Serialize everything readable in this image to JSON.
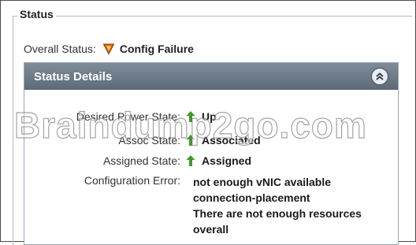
{
  "group": {
    "legend": "Status"
  },
  "overall": {
    "label": "Overall Status:",
    "value": "Config Failure",
    "icon": "warning-triangle-icon",
    "icon_color": "#e06a10"
  },
  "details": {
    "title": "Status Details",
    "collapse_icon": "chevron-double-up-icon",
    "rows": [
      {
        "label": "Desired Power State:",
        "value": "Up",
        "icon": "arrow-up-icon"
      },
      {
        "label": "Assoc State:",
        "value": "Associated",
        "icon": "arrow-up-icon"
      },
      {
        "label": "Assigned State:",
        "value": "Assigned",
        "icon": "arrow-up-icon"
      }
    ],
    "config_error": {
      "label": "Configuration Error:",
      "lines": [
        "not enough vNIC available",
        "connection-placement",
        "There are not enough resources",
        "overall"
      ]
    }
  },
  "watermark": "Braindump2go.com",
  "colors": {
    "header": "#6b7886",
    "success_arrow": "#3f9a2a",
    "fail": "#e06a10"
  }
}
